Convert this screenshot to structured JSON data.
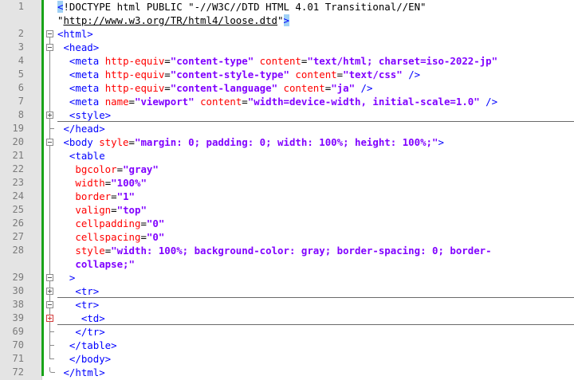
{
  "editor": {
    "lines": [
      {
        "num": "1",
        "segs": [
          {
            "c": "caret-hl t",
            "t": "<"
          },
          {
            "c": "d",
            "t": "!DOCTYPE html PUBLIC \"-//W3C//DTD HTML 4.01 Transitional//EN\""
          }
        ]
      },
      {
        "num": "",
        "segs": [
          {
            "c": "d",
            "t": "\""
          },
          {
            "c": "u",
            "t": "http://www.w3.org/TR/html4/loose.dtd"
          },
          {
            "c": "d",
            "t": "\""
          },
          {
            "c": "caret-hl t",
            "t": ">"
          }
        ]
      },
      {
        "num": "2",
        "segs": [
          {
            "c": "t",
            "t": "<html>"
          }
        ]
      },
      {
        "num": "3",
        "segs": [
          {
            "c": "t",
            "t": " <head>"
          }
        ]
      },
      {
        "num": "4",
        "segs": [
          {
            "c": "t",
            "t": "  <meta "
          },
          {
            "c": "a",
            "t": "http-equiv"
          },
          {
            "c": "d",
            "t": "="
          },
          {
            "c": "v",
            "t": "\"content-type\""
          },
          {
            "c": "a",
            "t": " content"
          },
          {
            "c": "d",
            "t": "="
          },
          {
            "c": "v",
            "t": "\"text/html; charset=iso-2022-jp\""
          }
        ]
      },
      {
        "num": "5",
        "segs": [
          {
            "c": "t",
            "t": "  <meta "
          },
          {
            "c": "a",
            "t": "http-equiv"
          },
          {
            "c": "d",
            "t": "="
          },
          {
            "c": "v",
            "t": "\"content-style-type\""
          },
          {
            "c": "a",
            "t": " content"
          },
          {
            "c": "d",
            "t": "="
          },
          {
            "c": "v",
            "t": "\"text/css\""
          },
          {
            "c": "t",
            "t": " />"
          }
        ]
      },
      {
        "num": "6",
        "segs": [
          {
            "c": "t",
            "t": "  <meta "
          },
          {
            "c": "a",
            "t": "http-equiv"
          },
          {
            "c": "d",
            "t": "="
          },
          {
            "c": "v",
            "t": "\"content-language\""
          },
          {
            "c": "a",
            "t": " content"
          },
          {
            "c": "d",
            "t": "="
          },
          {
            "c": "v",
            "t": "\"ja\""
          },
          {
            "c": "t",
            "t": " />"
          }
        ]
      },
      {
        "num": "7",
        "segs": [
          {
            "c": "t",
            "t": "  <meta "
          },
          {
            "c": "a",
            "t": "name"
          },
          {
            "c": "d",
            "t": "="
          },
          {
            "c": "v",
            "t": "\"viewport\""
          },
          {
            "c": "a",
            "t": " content"
          },
          {
            "c": "d",
            "t": "="
          },
          {
            "c": "v",
            "t": "\"width=device-width, initial-scale=1.0\""
          },
          {
            "c": "t",
            "t": " />"
          }
        ]
      },
      {
        "num": "8",
        "segs": [
          {
            "c": "t",
            "t": "  <style>"
          }
        ]
      },
      {
        "num": "19",
        "segs": [
          {
            "c": "t",
            "t": " </head>"
          }
        ]
      },
      {
        "num": "20",
        "segs": [
          {
            "c": "t",
            "t": " <body "
          },
          {
            "c": "a",
            "t": "style"
          },
          {
            "c": "d",
            "t": "="
          },
          {
            "c": "v",
            "t": "\"margin: 0; padding: 0; width: 100%; height: 100%;\""
          },
          {
            "c": "t",
            "t": ">"
          }
        ]
      },
      {
        "num": "21",
        "segs": [
          {
            "c": "t",
            "t": "  <table"
          }
        ]
      },
      {
        "num": "22",
        "segs": [
          {
            "c": "a",
            "t": "   bgcolor"
          },
          {
            "c": "d",
            "t": "="
          },
          {
            "c": "v",
            "t": "\"gray\""
          }
        ]
      },
      {
        "num": "23",
        "segs": [
          {
            "c": "a",
            "t": "   width"
          },
          {
            "c": "d",
            "t": "="
          },
          {
            "c": "v",
            "t": "\"100%\""
          }
        ]
      },
      {
        "num": "24",
        "segs": [
          {
            "c": "a",
            "t": "   border"
          },
          {
            "c": "d",
            "t": "="
          },
          {
            "c": "v",
            "t": "\"1\""
          }
        ]
      },
      {
        "num": "25",
        "segs": [
          {
            "c": "a",
            "t": "   valign"
          },
          {
            "c": "d",
            "t": "="
          },
          {
            "c": "v",
            "t": "\"top\""
          }
        ]
      },
      {
        "num": "26",
        "segs": [
          {
            "c": "a",
            "t": "   cellpadding"
          },
          {
            "c": "d",
            "t": "="
          },
          {
            "c": "v",
            "t": "\"0\""
          }
        ]
      },
      {
        "num": "27",
        "segs": [
          {
            "c": "a",
            "t": "   cellspacing"
          },
          {
            "c": "d",
            "t": "="
          },
          {
            "c": "v",
            "t": "\"0\""
          }
        ]
      },
      {
        "num": "28",
        "segs": [
          {
            "c": "a",
            "t": "   style"
          },
          {
            "c": "d",
            "t": "="
          },
          {
            "c": "v",
            "t": "\"width: 100%; background-color: gray; border-spacing: 0; border-"
          }
        ]
      },
      {
        "num": "",
        "segs": [
          {
            "c": "v",
            "t": "   collapse;\""
          }
        ]
      },
      {
        "num": "29",
        "segs": [
          {
            "c": "t",
            "t": "  >"
          }
        ]
      },
      {
        "num": "30",
        "segs": [
          {
            "c": "t",
            "t": "   <tr>"
          }
        ]
      },
      {
        "num": "38",
        "segs": [
          {
            "c": "t",
            "t": "   <tr>"
          }
        ]
      },
      {
        "num": "39",
        "segs": [
          {
            "c": "t",
            "t": "    <td>"
          }
        ]
      },
      {
        "num": "69",
        "segs": [
          {
            "c": "t",
            "t": "   </tr>"
          }
        ]
      },
      {
        "num": "70",
        "segs": [
          {
            "c": "t",
            "t": "  </table>"
          }
        ]
      },
      {
        "num": "71",
        "segs": [
          {
            "c": "t",
            "t": "  </body>"
          }
        ]
      },
      {
        "num": "72",
        "segs": [
          {
            "c": "t",
            "t": " </html>"
          }
        ]
      }
    ]
  },
  "colors": {
    "tag": "#0000ff",
    "attribute": "#ff0000",
    "value": "#8000ff",
    "change_bar": "#19a319",
    "gutter": "#e4e4e4",
    "brace_highlight": "#9fd0f5"
  },
  "icons": {
    "fold_expanded": "minus-box-icon",
    "fold_collapsed": "plus-box-icon"
  }
}
